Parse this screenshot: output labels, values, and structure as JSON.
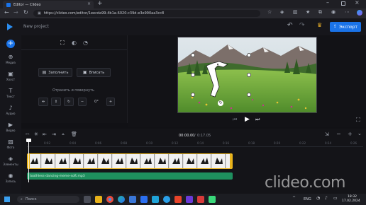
{
  "browser": {
    "tab_title": "Editor — Clideo",
    "url": "https://clideo.com/editor/1eecda99-4b1a-6020-c39d-e3e990aa3cc8"
  },
  "app": {
    "project_name": "New project",
    "export_label": "Экспорт"
  },
  "sidebar": {
    "items": [
      {
        "label": "Медиа",
        "icon": "media-icon"
      },
      {
        "label": "Холст",
        "icon": "canvas-icon"
      },
      {
        "label": "Текст",
        "icon": "text-icon"
      },
      {
        "label": "Аудио",
        "icon": "audio-icon"
      },
      {
        "label": "Видео",
        "icon": "video-icon"
      },
      {
        "label": "Фото",
        "icon": "photo-icon"
      },
      {
        "label": "Элементы",
        "icon": "elements-icon"
      },
      {
        "label": "Запись",
        "icon": "record-icon"
      }
    ]
  },
  "props": {
    "fill_label": "Заполнить",
    "fit_label": "Вписать",
    "rotate_title": "Отразить и повернуть",
    "angle_value": "0°"
  },
  "timeline": {
    "current_time": "00:00.00",
    "total_time": "0:17.05",
    "ruler": [
      "0:02",
      "0:04",
      "0:06",
      "0:08",
      "0:10",
      "0:12",
      "0:14",
      "0:16",
      "0:18",
      "0:20",
      "0:22",
      "0:24",
      "0:26"
    ],
    "audio_track_name": "toothless-dancing-meme-soft.mp3"
  },
  "watermark": "clideo.com",
  "taskbar": {
    "search_placeholder": "Поиск",
    "language": "ENG",
    "time": "18:32",
    "date": "17.02.2024"
  },
  "colors": {
    "accent": "#1a73e8",
    "clip_border": "#e8b21a",
    "audio_track": "#1e8f5e"
  }
}
